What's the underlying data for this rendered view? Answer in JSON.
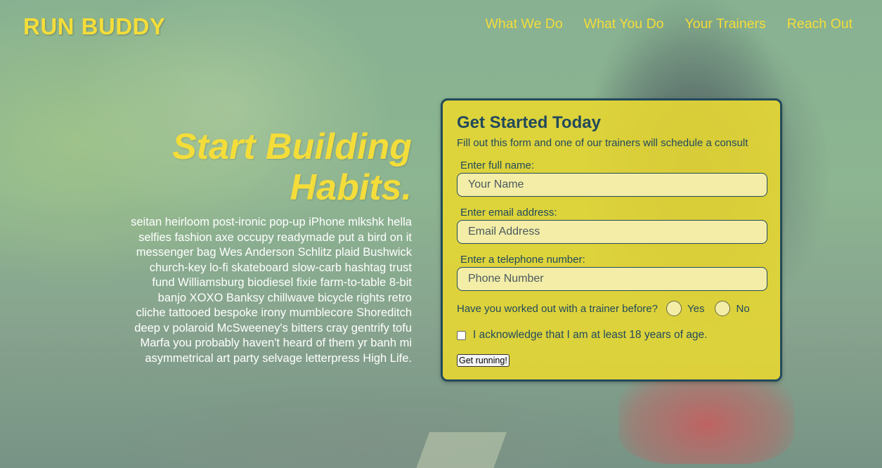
{
  "header": {
    "logo": "RUN BUDDY",
    "nav": [
      {
        "label": "What We Do"
      },
      {
        "label": "What You Do"
      },
      {
        "label": "Your Trainers"
      },
      {
        "label": "Reach Out"
      }
    ]
  },
  "hero": {
    "heading_line1": "Start Building",
    "heading_line2": "Habits.",
    "body": "seitan heirloom post-ironic pop-up iPhone mlkshk hella selfies fashion axe occupy readymade put a bird on it messenger bag Wes Anderson Schlitz plaid Bushwick church-key lo-fi skateboard slow-carb hashtag trust fund Williamsburg biodiesel fixie farm-to-table 8-bit banjo XOXO Banksy chillwave bicycle rights retro cliche tattooed bespoke irony mumblecore Shoreditch deep v polaroid McSweeney's bitters cray gentrify tofu Marfa you probably haven't heard of them yr banh mi asymmetrical art party selvage letterpress High Life."
  },
  "form": {
    "title": "Get Started Today",
    "subtitle": "Fill out this form and one of our trainers will schedule a consult",
    "name_label": "Enter full name:",
    "name_placeholder": "Your Name",
    "email_label": "Enter email address:",
    "email_placeholder": "Email Address",
    "phone_label": "Enter a telephone number:",
    "phone_placeholder": "Phone Number",
    "trainer_question": "Have you worked out with a trainer before?",
    "yes_label": "Yes",
    "no_label": "No",
    "age_ack": "I acknowledge that I am at least 18 years of age.",
    "submit_label": "Get running!"
  },
  "colors": {
    "accent_yellow": "#f4dd3a",
    "form_bg": "#e4d634",
    "form_text": "#224a5c",
    "input_bg": "#f3eda7"
  }
}
